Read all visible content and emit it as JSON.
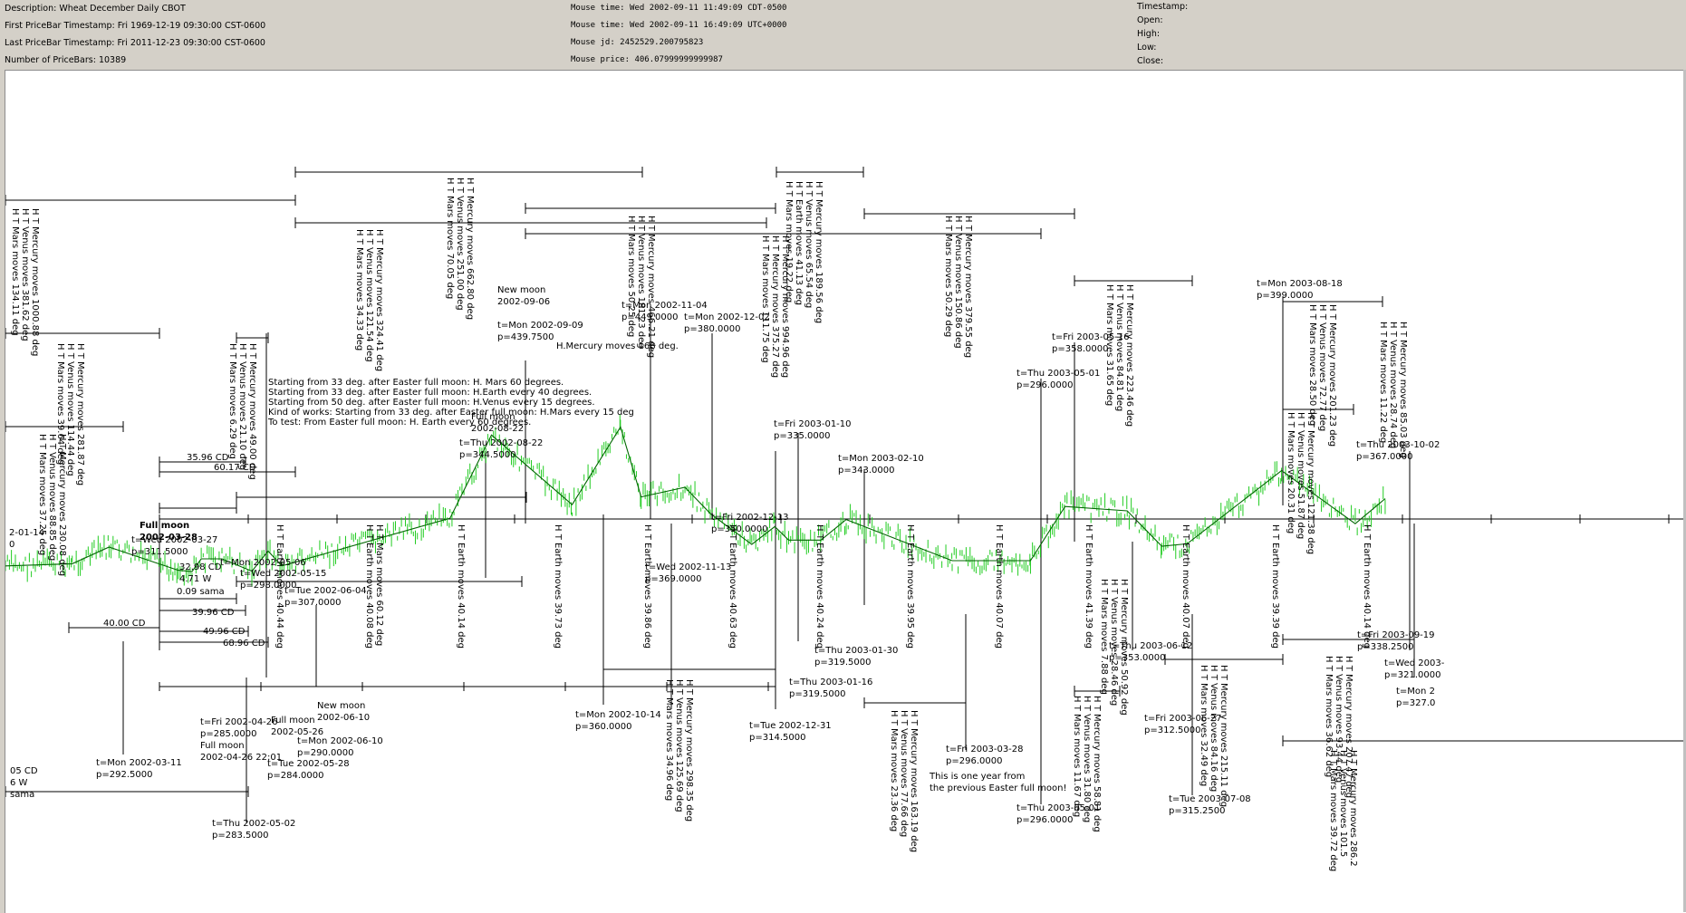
{
  "header": {
    "col1": [
      "Description: Wheat December Daily CBOT",
      "First PriceBar Timestamp: Fri 1969-12-19 09:30:00 CST-0600",
      "Last PriceBar Timestamp: Fri 2011-12-23 09:30:00 CST-0600",
      "Number of PriceBars: 10389"
    ],
    "col2": [
      "Mouse time: Wed 2002-09-11 11:49:09 CDT-0500",
      "Mouse time: Wed 2002-09-11 16:49:09 UTC+0000",
      "Mouse jd:    2452529.200795823",
      "Mouse price: 406.07999999999987"
    ],
    "col3": [
      "Timestamp:",
      "Open:",
      "High:",
      "Low:",
      "Close:"
    ]
  },
  "colors": {
    "background": "#d4d0c8",
    "panel": "#ffffff",
    "price_bars": "#22cc22",
    "zigzag": "#006600",
    "full_moon_label": "#3333cc",
    "lines": "#000000"
  },
  "chart_data": {
    "type": "line",
    "title": "",
    "instrument": "Wheat December Daily CBOT",
    "zigzag_series": {
      "name": "",
      "points": [
        [
          "2002-02-10",
          290
        ],
        [
          "2002-03-11",
          292.5
        ],
        [
          "2002-03-27",
          311.5
        ],
        [
          "2002-04-26",
          285
        ],
        [
          "2002-05-02",
          283.5
        ],
        [
          "2002-05-06",
          298
        ],
        [
          "2002-05-15",
          298
        ],
        [
          "2002-05-28",
          284
        ],
        [
          "2002-06-04",
          307
        ],
        [
          "2002-06-10",
          290
        ],
        [
          "2002-08-22",
          344.5
        ],
        [
          "2002-09-09",
          439.75
        ],
        [
          "2002-10-14",
          360
        ],
        [
          "2002-11-04",
          449
        ],
        [
          "2002-11-13",
          369
        ],
        [
          "2002-12-02",
          380
        ],
        [
          "2002-12-13",
          350
        ],
        [
          "2002-12-31",
          314.5
        ],
        [
          "2003-01-10",
          335
        ],
        [
          "2003-01-16",
          319.5
        ],
        [
          "2003-01-30",
          319.5
        ],
        [
          "2003-02-10",
          343
        ],
        [
          "2003-03-28",
          296
        ],
        [
          "2003-05-01",
          296
        ],
        [
          "2003-05-16",
          358
        ],
        [
          "2003-06-12",
          353
        ],
        [
          "2003-06-27",
          312.5
        ],
        [
          "2003-07-08",
          315.25
        ],
        [
          "2003-08-18",
          399
        ],
        [
          "2003-09-19",
          338.25
        ],
        [
          "2003-10-02",
          367
        ]
      ]
    },
    "pivot_labels": [
      {
        "lines": [
          "t=Wed 2002-03-27",
          "p=311.5000"
        ]
      },
      {
        "lines": [
          "t=Mon 2002-03-11",
          "p=292.5000"
        ]
      },
      {
        "lines": [
          "t=Fri 2002-04-26",
          "p=285.0000",
          "Full moon",
          "2002-04-26 22:01"
        ]
      },
      {
        "lines": [
          "t=Thu 2002-05-02",
          "p=283.5000"
        ]
      },
      {
        "lines": [
          "t=Mon 2002-05-06"
        ]
      },
      {
        "lines": [
          "t=Wed 2002-05-15",
          "p=298.0000"
        ]
      },
      {
        "lines": [
          "t=Tue 2002-05-28",
          "p=284.0000"
        ]
      },
      {
        "lines": [
          "Full moon",
          "2002-05-26"
        ]
      },
      {
        "lines": [
          "t=Tue 2002-06-04",
          "p=307.0000"
        ]
      },
      {
        "lines": [
          "t=Mon 2002-06-10",
          "p=290.0000"
        ]
      },
      {
        "lines": [
          "New moon",
          "2002-06-10"
        ]
      },
      {
        "lines": [
          "t=Thu 2002-08-22",
          "p=344.5000"
        ]
      },
      {
        "lines": [
          "Full moon",
          "2002-08-22"
        ]
      },
      {
        "lines": [
          "New moon",
          "2002-09-06",
          "",
          "t=Mon 2002-09-09",
          "p=439.7500"
        ]
      },
      {
        "lines": [
          "t=Mon 2002-11-04",
          "p=449.0000"
        ]
      },
      {
        "lines": [
          "t=Mon 2002-12-02",
          "p=380.0000"
        ]
      },
      {
        "lines": [
          "t=Mon 2002-10-14",
          "p=360.0000"
        ]
      },
      {
        "lines": [
          "t=Wed 2002-11-13",
          "p=369.0000"
        ]
      },
      {
        "lines": [
          "t=Fri 2002-12-13",
          "p=350.0000"
        ]
      },
      {
        "lines": [
          "t=Fri 2003-01-10",
          "p=335.0000"
        ]
      },
      {
        "lines": [
          "t=Tue 2002-12-31",
          "p=314.5000"
        ]
      },
      {
        "lines": [
          "t=Thu 2003-01-16",
          "p=319.5000"
        ]
      },
      {
        "lines": [
          "t=Thu 2003-01-30",
          "p=319.5000"
        ]
      },
      {
        "lines": [
          "t=Mon 2003-02-10",
          "p=343.0000"
        ]
      },
      {
        "lines": [
          "t=Fri 2003-03-28",
          "p=296.0000"
        ]
      },
      {
        "lines": [
          "This is one year from",
          "the previous Easter full moon!"
        ]
      },
      {
        "lines": [
          "t=Thu 2003-05-01",
          "p=296.0000"
        ]
      },
      {
        "lines": [
          "t=Thu 2003-05-01",
          "p=296.0000"
        ]
      },
      {
        "lines": [
          "t=Fri 2003-05-16",
          "p=358.0000"
        ]
      },
      {
        "lines": [
          "t=Thu 2003-06-12",
          "p=353.0000"
        ]
      },
      {
        "lines": [
          "t=Fri 2003-06-27",
          "p=312.5000"
        ]
      },
      {
        "lines": [
          "t=Tue 2003-07-08",
          "p=315.2500"
        ]
      },
      {
        "lines": [
          "t=Mon 2003-08-18",
          "p=399.0000"
        ]
      },
      {
        "lines": [
          "t=Thu 2003-10-02",
          "p=367.0000"
        ]
      },
      {
        "lines": [
          "t=Fri 2003-09-19",
          "p=338.2500"
        ]
      },
      {
        "lines": [
          "t=Wed 2003-",
          "p=321.0000"
        ]
      },
      {
        "lines": [
          "t=Mon 2",
          "p=327.0"
        ]
      },
      {
        "lines": [
          "2-01-14",
          "0"
        ]
      },
      {
        "lines": [
          "05 CD",
          "6 W",
          " sama"
        ]
      }
    ],
    "full_moon_label": [
      "Full moon",
      "2002-03-28"
    ],
    "measure_labels": [
      "35.96 CD",
      "60.17 CD",
      "32.98 CD",
      "4.71 W",
      "0.09 sama",
      "39.96 CD",
      "49.96 CD",
      "68.96 CD",
      "40.00 CD"
    ],
    "notes": [
      "Starting from 33 deg. after Easter full moon: H. Mars 60 degrees.",
      "Starting from 33 deg. after Easter full moon: H.Earth every 40 degrees.",
      "Starting from 50 deg. after Easter full moon: H.Venus every 15 degrees.",
      "Kind of works: Starting from 33 deg. after Easter full moon: H.Mars every 15 deg",
      "To test: From Easter full moon: H. Earth every 60 degrees.",
      "H.Mercury moves 168 deg."
    ],
    "vertical_labels": [
      [
        "H T Mercury moves 1000.88 deg",
        "H T Venus moves 381.62 deg",
        "H T Mars moves 134.11 deg"
      ],
      [
        "H T Mercury moves 281.87 deg",
        "H T Venus moves 114.44 deg",
        "H T Mars moves 39.64 deg"
      ],
      [
        "H T Mercury moves 230.08 deg",
        "H T Venus moves 88.85 deg",
        "H T Mars moves 37.25 deg"
      ],
      [
        "H T Mercury moves 49.00 deg",
        "H T Venus moves 21.10 deg",
        "H T Mars moves 6.29 deg"
      ],
      [
        "H T Mercury moves 324.41 deg",
        "H T Venus moves 121.54 deg",
        "H T Mars moves 34.33 deg"
      ],
      [
        "H T Mercury moves 662.80 deg",
        "H T Venus moves 251.00 deg",
        "H T Mars moves 70.05 deg"
      ],
      [
        "H T Mercury moves 466.21 deg",
        "H T Venus moves 181.23 deg",
        "H T Mars moves 50.25 deg"
      ],
      [
        "H T Mercury moves 189.56 deg",
        "H T Venus moves 65.54 deg",
        "H T Earth moves 41.13 deg",
        "H T Mars moves 19.22 deg"
      ],
      [
        "H T Mercury moves 994.96 deg",
        "H T Mercury moves 375.27 deg",
        "H T Mars moves 111.75 deg"
      ],
      [
        "H T Mercury moves 379.55 deg",
        "H T Venus moves 150.86 deg",
        "H T Mars moves 50.29 deg"
      ],
      [
        "H T Mercury moves 223.46 deg",
        "H T Venus moves 84.81 deg",
        "H T Mars moves 31.65 deg"
      ],
      [
        "H T Mercury moves 201.23 deg",
        "H T Venus moves 72.77 deg",
        "H T Mars moves 28.50 deg"
      ],
      [
        "H T Mercury moves 85.03 deg",
        "H T Venus moves 28.74 deg",
        "H T Mars moves 11.22 deg"
      ],
      [
        "H T Mercury moves 121.38 deg",
        "H T Venus moves 51.87 deg",
        "H T Mars moves 20.31 deg"
      ],
      [
        "H T Mars moves 60.12 deg",
        "H T Earth moves 40.08 deg"
      ],
      [
        "H T Earth moves 40.44 deg"
      ],
      [
        "H T Earth moves 40.14 deg"
      ],
      [
        "H T Mercury moves 50.92 deg",
        "H T Venus moves 28.46 deg",
        "H T Mars moves 7.88 deg"
      ],
      [
        "H T Earth moves 39.73 deg"
      ],
      [
        "H T Earth moves 39.86 deg"
      ],
      [
        "H T Earth moves 40.63 deg"
      ],
      [
        "H T Earth moves 40.24 deg"
      ],
      [
        "H T Earth moves 39.95 deg"
      ],
      [
        "H T Earth moves 40.07 deg"
      ],
      [
        "H T Earth moves 41.39 deg"
      ],
      [
        "H T Earth moves 40.07 deg"
      ],
      [
        "H T Earth moves 39.39 deg"
      ],
      [
        "H T Earth moves 40.14 deg"
      ],
      [
        "H T Mercury moves 298.35 deg",
        "H T Venus moves 125.69 deg",
        "H T Mars moves 34.96 deg"
      ],
      [
        "H T Mercury moves 163.19 deg",
        "H T Venus moves 77.66 deg",
        "H T Mars moves 23.36 deg"
      ],
      [
        "H T Mercury moves 58.81 deg",
        "H T Venus moves 31.80 deg",
        "H T Mars moves 11.67 deg"
      ],
      [
        "H T Mercury moves 215.11 deg",
        "H T Venus moves 84.16 deg",
        "H T Mars moves 32.49 deg"
      ],
      [
        "H T Mercury moves 207.47 deg",
        "H T Venus moves 93.44 deg",
        "H T Mars moves 36.62 deg"
      ],
      [
        "H T Mercury moves 286.2",
        "H T Venus moves 101.5",
        "H T Mars moves 39.72 deg"
      ]
    ]
  }
}
